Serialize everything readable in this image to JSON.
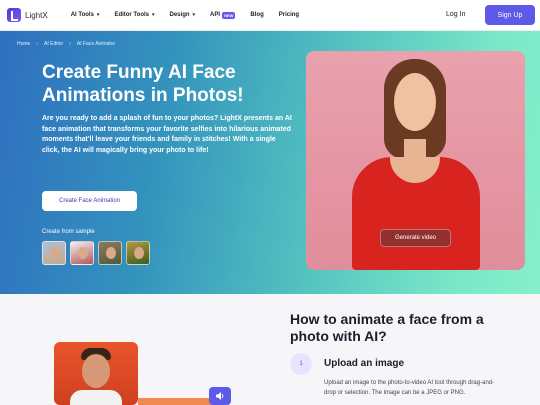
{
  "nav": {
    "logo_text": "LightX",
    "items": [
      {
        "label": "AI Tools",
        "has_chevron": true
      },
      {
        "label": "Editor Tools",
        "has_chevron": true
      },
      {
        "label": "Design",
        "has_chevron": true
      },
      {
        "label": "API",
        "badge": "NEW"
      },
      {
        "label": "Blog"
      },
      {
        "label": "Pricing"
      }
    ],
    "login_label": "Log In",
    "signup_label": "Sign Up",
    "brand_color": "#5c5ae6"
  },
  "breadcrumb": [
    "Home",
    "AI Editor",
    "AI Face Animator"
  ],
  "hero": {
    "title": "Create Funny AI Face Animations in Photos!",
    "description": "Are you ready to add a splash of fun to your photos? LightX presents an AI face animation that transforms your favorite selfies into hilarious animated moments that'll leave your friends and family in stitches! With a single click, the AI will magically bring your photo to life!",
    "cta_label": "Create Face Animation",
    "sample_label": "Create from sample",
    "generate_label": "Generate video"
  },
  "how_to": {
    "title": "How to animate a face from a photo with AI?",
    "step_number": "1",
    "step_title": "Upload an image",
    "step_desc": "Upload an image to the photo-to-video AI tool through drag-and-drop or selection. The image can be a JPEG or PNG."
  }
}
